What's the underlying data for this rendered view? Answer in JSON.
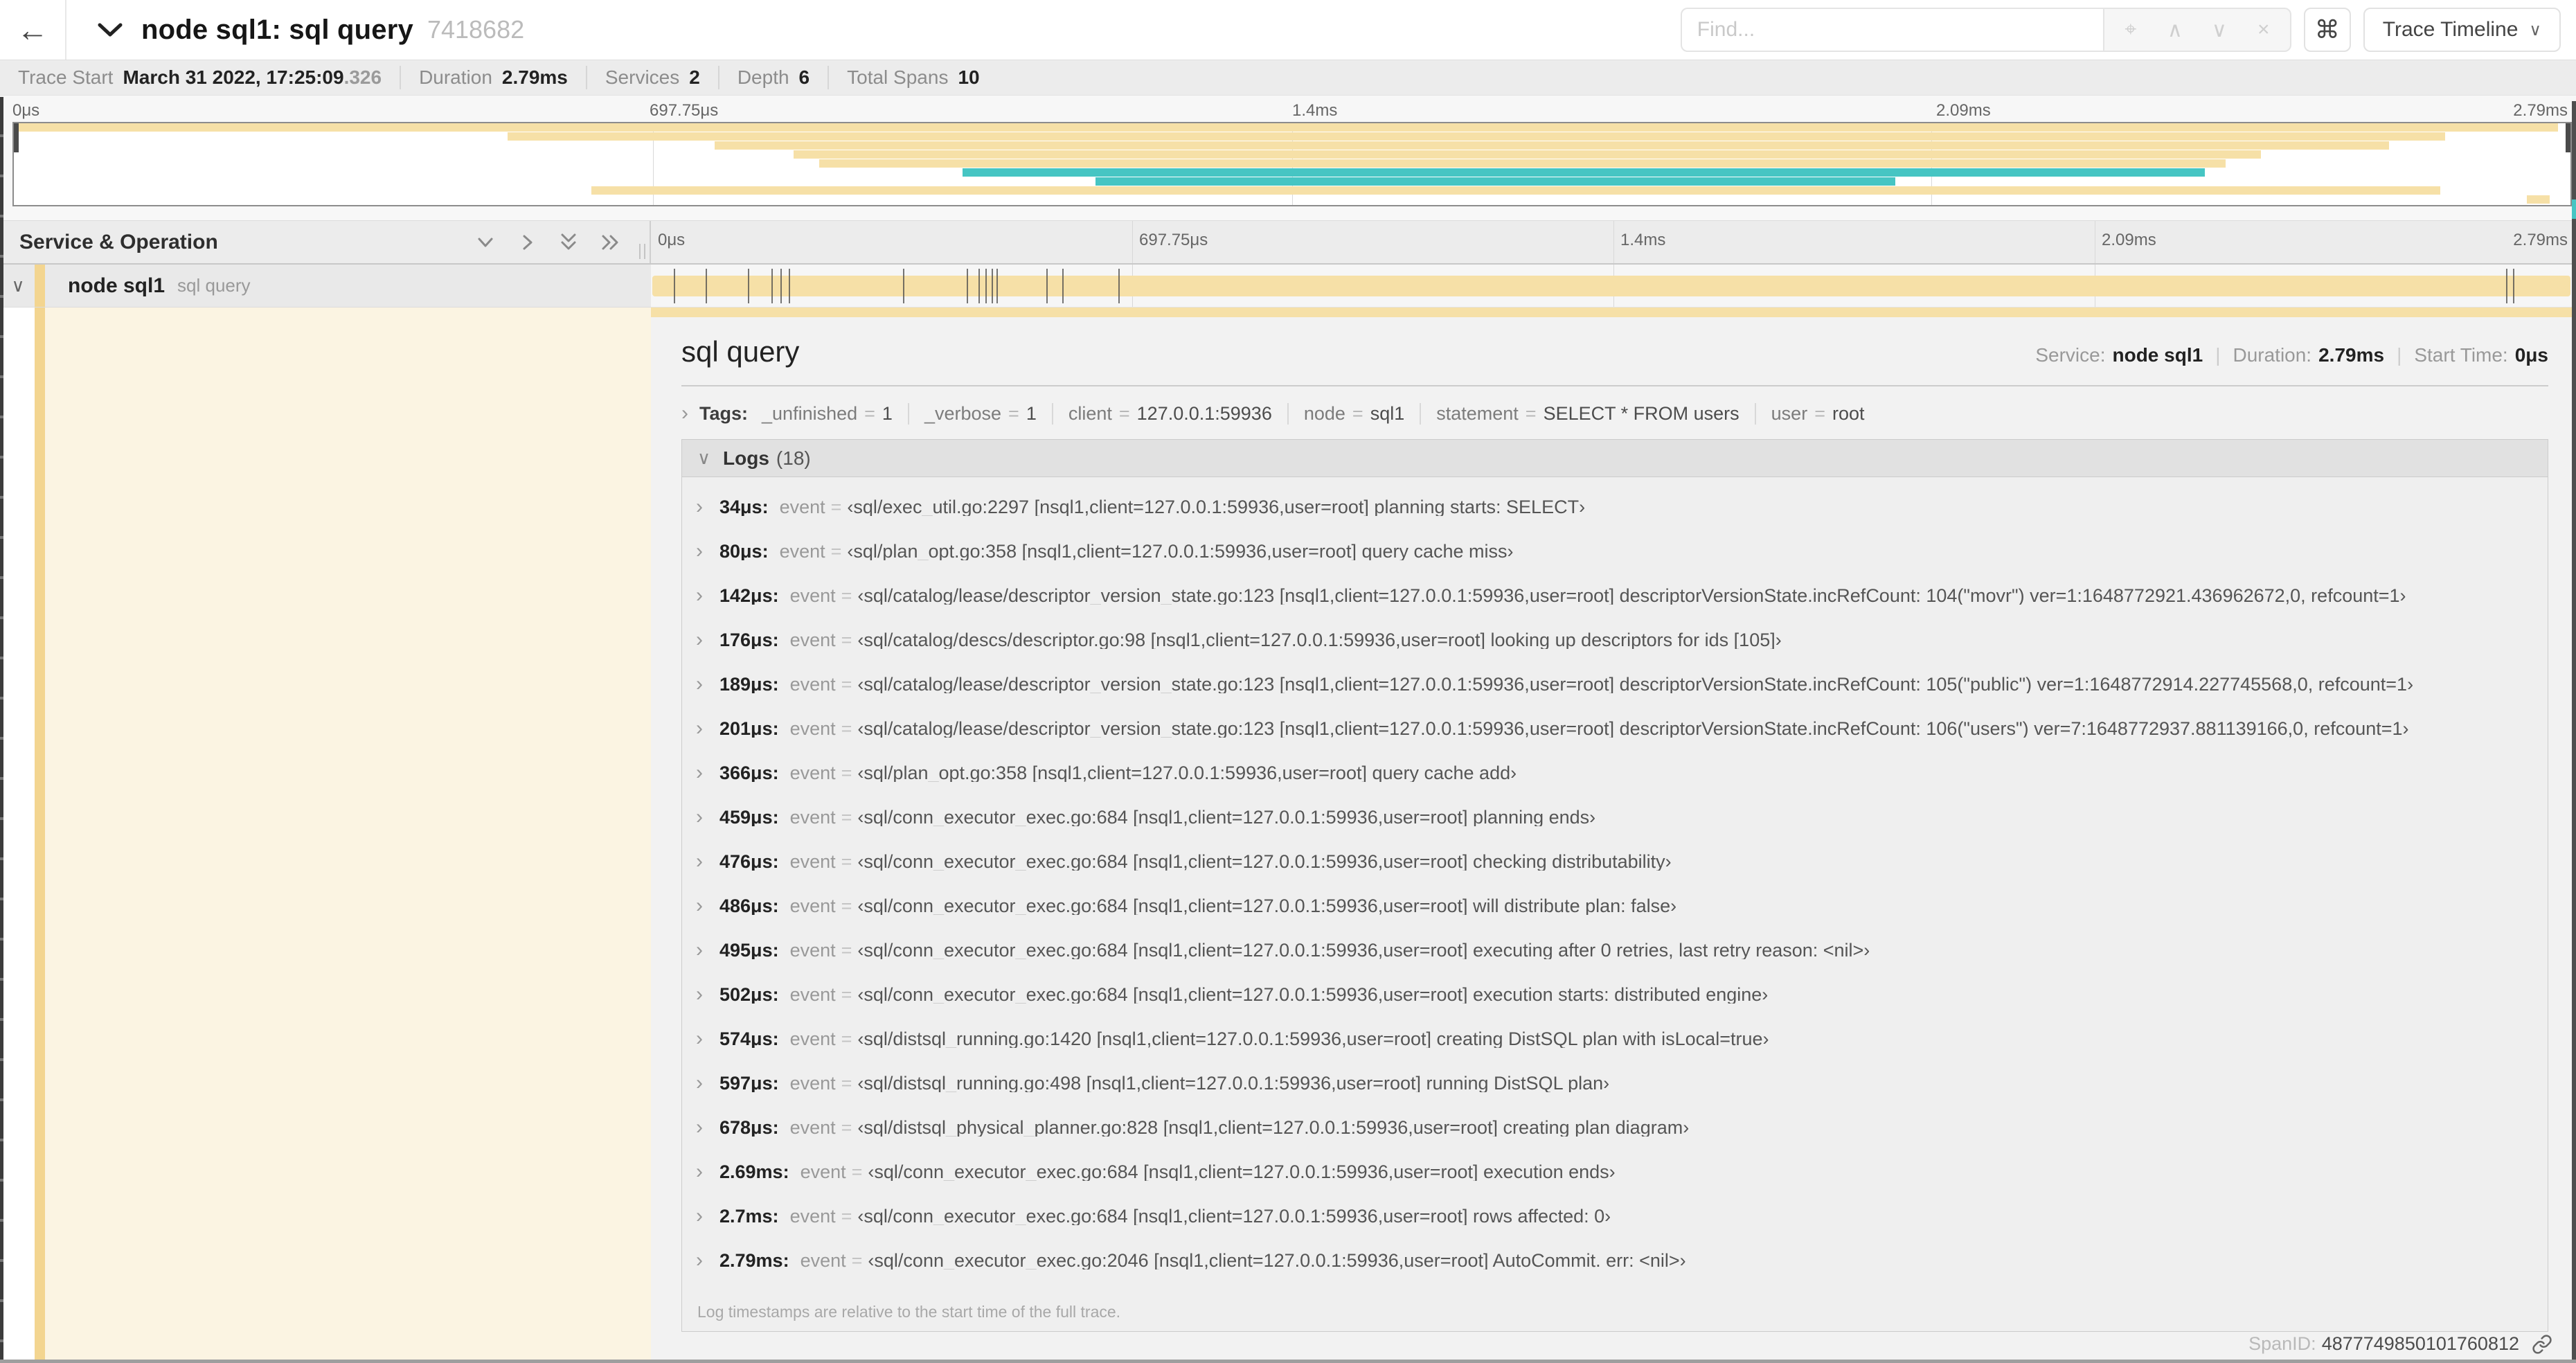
{
  "header": {
    "back_icon": "←",
    "title": "node sql1: sql query",
    "trace_id": "7418682",
    "find_placeholder": "Find...",
    "shortcut_icon": "⌘",
    "trace_timeline_label": "Trace Timeline"
  },
  "summary": {
    "trace_start_label": "Trace Start",
    "trace_start_value": "March 31 2022, 17:25:09",
    "trace_start_ms": ".326",
    "duration_label": "Duration",
    "duration_value": "2.79ms",
    "services_label": "Services",
    "services_value": "2",
    "depth_label": "Depth",
    "depth_value": "6",
    "total_spans_label": "Total Spans",
    "total_spans_value": "10"
  },
  "timeline": {
    "column_header": "Service & Operation",
    "ticks": [
      "0μs",
      "697.75μs",
      "1.4ms",
      "2.09ms",
      "2.79ms"
    ],
    "duration_us": 2790
  },
  "minimap": {
    "spans": [
      {
        "start": 0.0,
        "end": 0.995,
        "color": "tan"
      },
      {
        "start": 0.193,
        "end": 0.951,
        "color": "tan"
      },
      {
        "start": 0.274,
        "end": 0.929,
        "color": "tan"
      },
      {
        "start": 0.305,
        "end": 0.879,
        "color": "tan"
      },
      {
        "start": 0.315,
        "end": 0.865,
        "color": "tan"
      },
      {
        "start": 0.371,
        "end": 0.857,
        "color": "teal"
      },
      {
        "start": 0.423,
        "end": 0.736,
        "color": "teal"
      },
      {
        "start": 0.226,
        "end": 0.949,
        "color": "tan"
      },
      {
        "start": 0.983,
        "end": 0.992,
        "color": "tan"
      }
    ]
  },
  "span": {
    "service": "node sql1",
    "operation": "sql query"
  },
  "detail": {
    "title": "sql query",
    "service_label": "Service:",
    "service_value": "node sql1",
    "duration_label": "Duration:",
    "duration_value": "2.79ms",
    "start_time_label": "Start Time:",
    "start_time_value": "0μs",
    "tags_label": "Tags:",
    "tags": [
      {
        "key": "_unfinished",
        "value": "1"
      },
      {
        "key": "_verbose",
        "value": "1"
      },
      {
        "key": "client",
        "value": "127.0.0.1:59936"
      },
      {
        "key": "node",
        "value": "sql1"
      },
      {
        "key": "statement",
        "value": "SELECT * FROM users"
      },
      {
        "key": "user",
        "value": "root"
      }
    ],
    "logs_label": "Logs",
    "logs_count": "(18)",
    "logs": [
      {
        "t": "34μs",
        "us": 34,
        "field": "event",
        "value": "‹sql/exec_util.go:2297 [nsql1,client=127.0.0.1:59936,user=root] planning starts: SELECT›"
      },
      {
        "t": "80μs",
        "us": 80,
        "field": "event",
        "value": "‹sql/plan_opt.go:358 [nsql1,client=127.0.0.1:59936,user=root] query cache miss›"
      },
      {
        "t": "142μs",
        "us": 142,
        "field": "event",
        "value": "‹sql/catalog/lease/descriptor_version_state.go:123 [nsql1,client=127.0.0.1:59936,user=root] descriptorVersionState.incRefCount: 104(\"movr\") ver=1:1648772921.436962672,0, refcount=1›"
      },
      {
        "t": "176μs",
        "us": 176,
        "field": "event",
        "value": "‹sql/catalog/descs/descriptor.go:98 [nsql1,client=127.0.0.1:59936,user=root] looking up descriptors for ids [105]›"
      },
      {
        "t": "189μs",
        "us": 189,
        "field": "event",
        "value": "‹sql/catalog/lease/descriptor_version_state.go:123 [nsql1,client=127.0.0.1:59936,user=root] descriptorVersionState.incRefCount: 105(\"public\") ver=1:1648772914.227745568,0, refcount=1›"
      },
      {
        "t": "201μs",
        "us": 201,
        "field": "event",
        "value": "‹sql/catalog/lease/descriptor_version_state.go:123 [nsql1,client=127.0.0.1:59936,user=root] descriptorVersionState.incRefCount: 106(\"users\") ver=7:1648772937.881139166,0, refcount=1›"
      },
      {
        "t": "366μs",
        "us": 366,
        "field": "event",
        "value": "‹sql/plan_opt.go:358 [nsql1,client=127.0.0.1:59936,user=root] query cache add›"
      },
      {
        "t": "459μs",
        "us": 459,
        "field": "event",
        "value": "‹sql/conn_executor_exec.go:684 [nsql1,client=127.0.0.1:59936,user=root] planning ends›"
      },
      {
        "t": "476μs",
        "us": 476,
        "field": "event",
        "value": "‹sql/conn_executor_exec.go:684 [nsql1,client=127.0.0.1:59936,user=root] checking distributability›"
      },
      {
        "t": "486μs",
        "us": 486,
        "field": "event",
        "value": "‹sql/conn_executor_exec.go:684 [nsql1,client=127.0.0.1:59936,user=root] will distribute plan: false›"
      },
      {
        "t": "495μs",
        "us": 495,
        "field": "event",
        "value": "‹sql/conn_executor_exec.go:684 [nsql1,client=127.0.0.1:59936,user=root] executing after 0 retries, last retry reason: <nil>›"
      },
      {
        "t": "502μs",
        "us": 502,
        "field": "event",
        "value": "‹sql/conn_executor_exec.go:684 [nsql1,client=127.0.0.1:59936,user=root] execution starts: distributed engine›"
      },
      {
        "t": "574μs",
        "us": 574,
        "field": "event",
        "value": "‹sql/distsql_running.go:1420 [nsql1,client=127.0.0.1:59936,user=root] creating DistSQL plan with isLocal=true›"
      },
      {
        "t": "597μs",
        "us": 597,
        "field": "event",
        "value": "‹sql/distsql_running.go:498 [nsql1,client=127.0.0.1:59936,user=root] running DistSQL plan›"
      },
      {
        "t": "678μs",
        "us": 678,
        "field": "event",
        "value": "‹sql/distsql_physical_planner.go:828 [nsql1,client=127.0.0.1:59936,user=root] creating plan diagram›"
      },
      {
        "t": "2.69ms",
        "us": 2690,
        "field": "event",
        "value": "‹sql/conn_executor_exec.go:684 [nsql1,client=127.0.0.1:59936,user=root] execution ends›"
      },
      {
        "t": "2.7ms",
        "us": 2700,
        "field": "event",
        "value": "‹sql/conn_executor_exec.go:684 [nsql1,client=127.0.0.1:59936,user=root] rows affected: 0›"
      },
      {
        "t": "2.79ms",
        "us": 2790,
        "field": "event",
        "value": "‹sql/conn_executor_exec.go:2046 [nsql1,client=127.0.0.1:59936,user=root] AutoCommit. err: <nil>›"
      }
    ],
    "logs_footnote": "Log timestamps are relative to the start time of the full trace.",
    "spanid_label": "SpanID:",
    "spanid_value": "4877749850101760812"
  },
  "colors": {
    "tan": "#F6E0A7",
    "tan_accent": "#F3D590",
    "teal": "#46C5C3",
    "cream": "#FBF4E2"
  }
}
